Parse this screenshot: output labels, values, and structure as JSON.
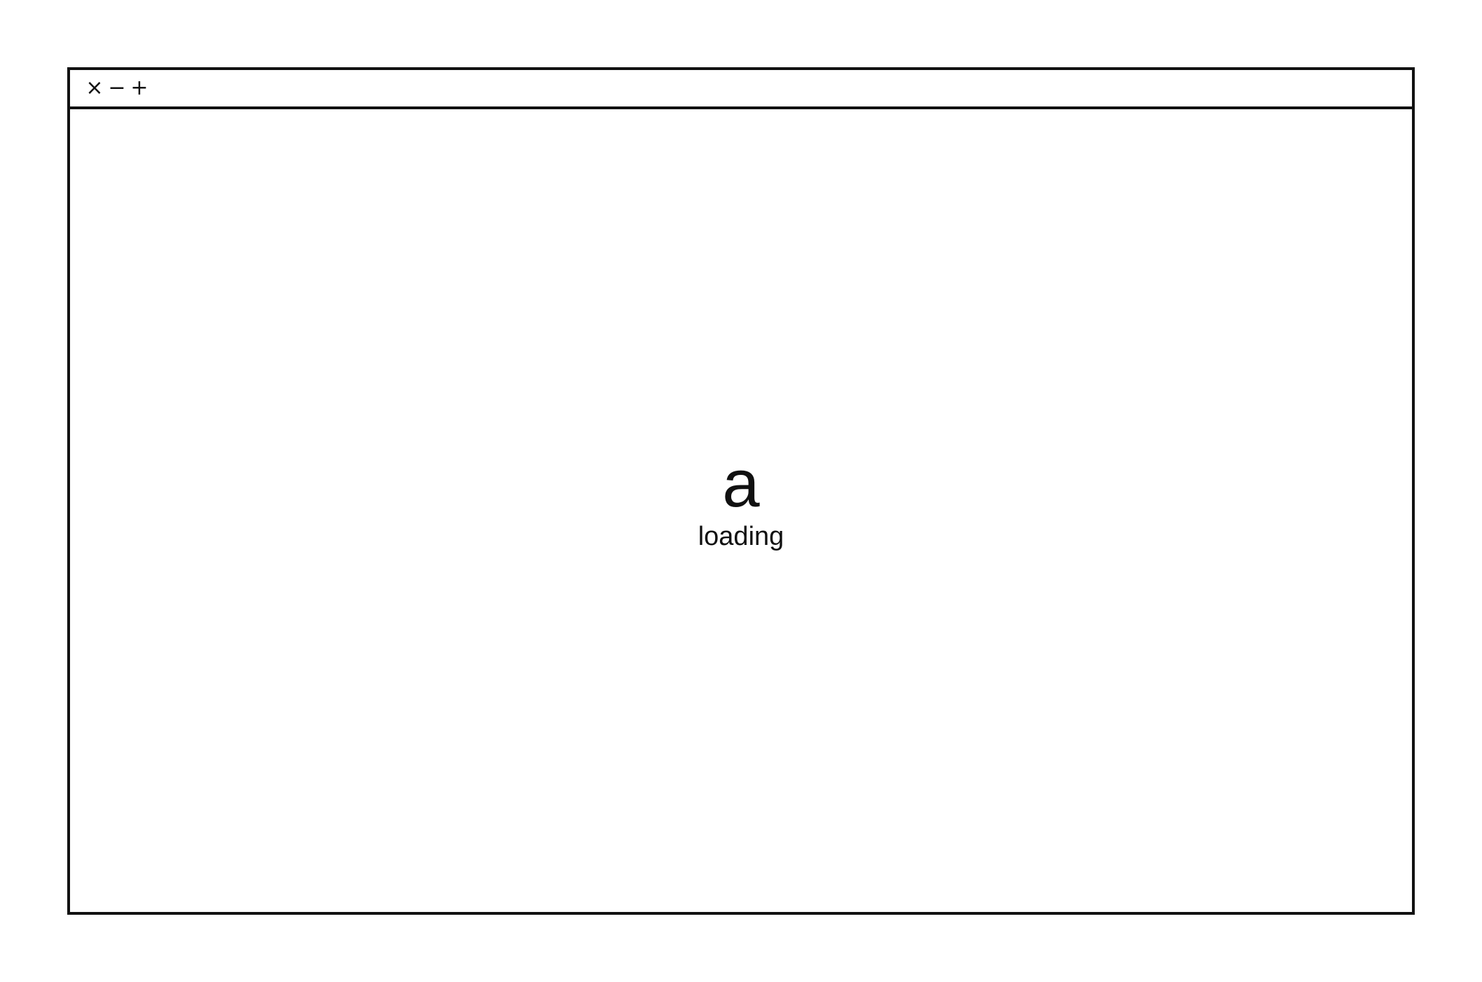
{
  "window": {
    "controls": {
      "close": "×",
      "minimize": "−",
      "maximize": "+"
    }
  },
  "loading": {
    "logo_text": "a",
    "status_text": "loading"
  },
  "colors": {
    "foreground": "#111111",
    "background": "#ffffff"
  }
}
